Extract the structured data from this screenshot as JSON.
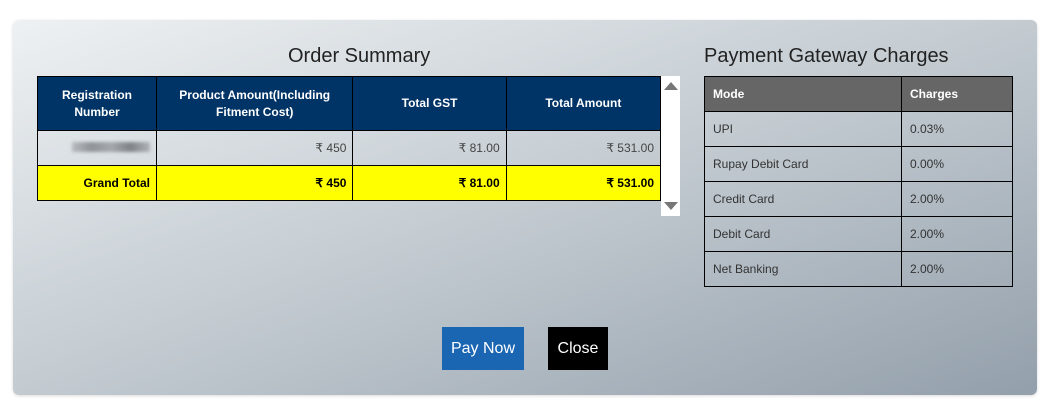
{
  "order_summary": {
    "title": "Order Summary",
    "headers": [
      "Registration Number",
      "Product Amount(Including Fitment Cost)",
      "Total GST",
      "Total Amount"
    ],
    "rows": [
      {
        "registration": "",
        "product_amount": "₹ 450",
        "total_gst": "₹ 81.00",
        "total_amount": "₹ 531.00"
      }
    ],
    "grand_total": {
      "label": "Grand Total",
      "product_amount": "₹ 450",
      "total_gst": "₹ 81.00",
      "total_amount": "₹ 531.00"
    }
  },
  "payment_gateway": {
    "title": "Payment Gateway Charges",
    "headers": [
      "Mode",
      "Charges"
    ],
    "rows": [
      {
        "mode": "UPI",
        "charges": "0.03%"
      },
      {
        "mode": "Rupay Debit Card",
        "charges": "0.00%"
      },
      {
        "mode": "Credit Card",
        "charges": "2.00%"
      },
      {
        "mode": "Debit Card",
        "charges": "2.00%"
      },
      {
        "mode": "Net Banking",
        "charges": "2.00%"
      }
    ]
  },
  "buttons": {
    "pay_now": "Pay Now",
    "close": "Close"
  },
  "colors": {
    "header_blue": "#003366",
    "grand_total_yellow": "#ffff00",
    "pg_header_gray": "#666666",
    "pay_button": "#1a66b3",
    "close_button": "#000000"
  }
}
